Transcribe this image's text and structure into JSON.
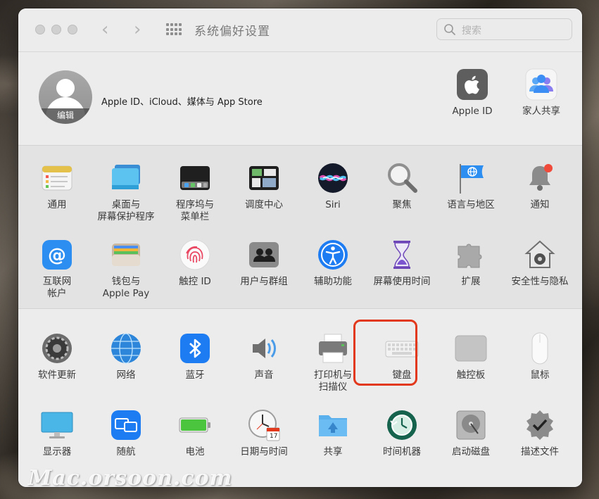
{
  "window": {
    "title": "系统偏好设置"
  },
  "search": {
    "placeholder": "搜索"
  },
  "account": {
    "avatar_edit": "编辑",
    "label": "Apple ID、iCloud、媒体与 App Store",
    "items": [
      {
        "name": "apple-id",
        "label": "Apple ID",
        "icon": "apple-icon"
      },
      {
        "name": "family-sharing",
        "label": "家人共享",
        "icon": "family-icon"
      }
    ]
  },
  "section1": {
    "row1": [
      {
        "label": "通用",
        "icon": "general-icon"
      },
      {
        "label": "桌面与\n屏幕保护程序",
        "icon": "desktop-icon"
      },
      {
        "label": "程序坞与\n菜单栏",
        "icon": "dock-icon"
      },
      {
        "label": "调度中心",
        "icon": "mission-control-icon"
      },
      {
        "label": "Siri",
        "icon": "siri-icon"
      },
      {
        "label": "聚焦",
        "icon": "spotlight-icon"
      },
      {
        "label": "语言与地区",
        "icon": "language-icon"
      },
      {
        "label": "通知",
        "icon": "notifications-icon"
      }
    ],
    "row2": [
      {
        "label": "互联网\n帐户",
        "icon": "internet-accounts-icon"
      },
      {
        "label": "钱包与\nApple Pay",
        "icon": "wallet-icon"
      },
      {
        "label": "触控 ID",
        "icon": "touch-id-icon"
      },
      {
        "label": "用户与群组",
        "icon": "users-icon"
      },
      {
        "label": "辅助功能",
        "icon": "accessibility-icon"
      },
      {
        "label": "屏幕使用时间",
        "icon": "screen-time-icon"
      },
      {
        "label": "扩展",
        "icon": "extensions-icon"
      },
      {
        "label": "安全性与隐私",
        "icon": "security-icon"
      }
    ]
  },
  "section2": {
    "row1": [
      {
        "label": "软件更新",
        "icon": "software-update-icon"
      },
      {
        "label": "网络",
        "icon": "network-icon"
      },
      {
        "label": "蓝牙",
        "icon": "bluetooth-icon"
      },
      {
        "label": "声音",
        "icon": "sound-icon"
      },
      {
        "label": "打印机与\n扫描仪",
        "icon": "printer-icon"
      },
      {
        "label": "键盘",
        "icon": "keyboard-icon"
      },
      {
        "label": "触控板",
        "icon": "trackpad-icon"
      },
      {
        "label": "鼠标",
        "icon": "mouse-icon"
      }
    ],
    "row2": [
      {
        "label": "显示器",
        "icon": "display-icon"
      },
      {
        "label": "随航",
        "icon": "sidecar-icon"
      },
      {
        "label": "电池",
        "icon": "battery-icon"
      },
      {
        "label": "日期与时间",
        "icon": "date-time-icon"
      },
      {
        "label": "共享",
        "icon": "sharing-icon"
      },
      {
        "label": "时间机器",
        "icon": "time-machine-icon"
      },
      {
        "label": "启动磁盘",
        "icon": "startup-disk-icon"
      },
      {
        "label": "描述文件",
        "icon": "profiles-icon"
      }
    ]
  },
  "calendar_day": "17",
  "colors": {
    "highlight": "#e2391d",
    "accent_blue": "#1e7cf2"
  },
  "watermark": "Mac.orsoon.com"
}
